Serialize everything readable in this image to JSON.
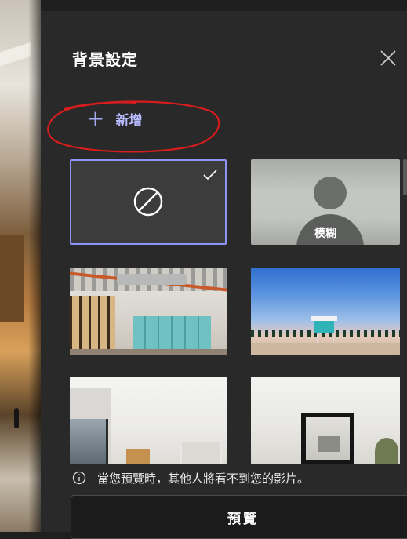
{
  "panel": {
    "title": "背景設定",
    "close_icon": "close-icon",
    "add_label": "新增",
    "add_icon": "plus-icon"
  },
  "backgrounds": [
    {
      "id": "none",
      "label": "",
      "selected": true,
      "icon": "no-background-icon"
    },
    {
      "id": "blur",
      "label": "模糊",
      "selected": false
    },
    {
      "id": "office",
      "label": "",
      "selected": false
    },
    {
      "id": "beach",
      "label": "",
      "selected": false
    },
    {
      "id": "room-1",
      "label": "",
      "selected": false
    },
    {
      "id": "room-2",
      "label": "",
      "selected": false
    }
  ],
  "info": {
    "icon": "info-icon",
    "text": "當您預覽時，其他人將看不到您的影片。"
  },
  "preview_button": {
    "label": "預覽"
  },
  "colors": {
    "panel_bg": "#292929",
    "accent": "#8f94f7",
    "annotation_red": "#d61c1c"
  }
}
